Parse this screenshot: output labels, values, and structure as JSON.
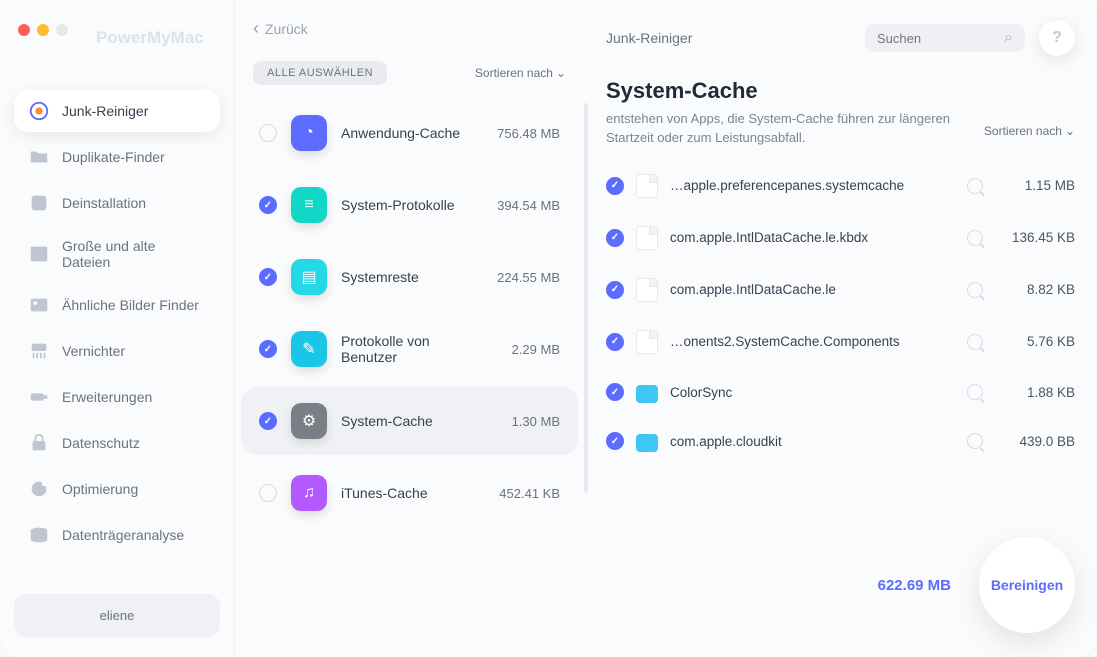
{
  "brand": "PowerMyMac",
  "back_label": "Zurück",
  "page_title": "Junk-Reiniger",
  "search": {
    "placeholder": "Suchen"
  },
  "help_label": "?",
  "sidebar": {
    "items": [
      {
        "label": "Junk-Reiniger",
        "active": true,
        "icon": "junk"
      },
      {
        "label": "Duplikate-Finder",
        "icon": "folder"
      },
      {
        "label": "Deinstallation",
        "icon": "app"
      },
      {
        "label": "Große und alte Dateien",
        "icon": "box"
      },
      {
        "label": "Ähnliche Bilder Finder",
        "icon": "image"
      },
      {
        "label": "Vernichter",
        "icon": "shred"
      },
      {
        "label": "Erweiterungen",
        "icon": "ext"
      },
      {
        "label": "Datenschutz",
        "icon": "lock"
      },
      {
        "label": "Optimierung",
        "icon": "opt"
      },
      {
        "label": "Datenträgeranalyse",
        "icon": "disk"
      }
    ],
    "user": "eliene"
  },
  "select_all": "ALLE AUSWÄHLEN",
  "sort_by": "Sortieren nach",
  "categories": [
    {
      "name": "Anwendung-Cache",
      "size": "756.48 MB",
      "checked": false,
      "color": "#5b6cff",
      "glyph": "clock"
    },
    {
      "name": "System-Protokolle",
      "size": "394.54 MB",
      "checked": true,
      "color": "#12d7c7",
      "glyph": "list"
    },
    {
      "name": "Systemreste",
      "size": "224.55 MB",
      "checked": true,
      "color": "#25d8e5",
      "glyph": "page"
    },
    {
      "name": "Protokolle von Benutzer",
      "size": "2.29 MB",
      "checked": true,
      "color": "#19c6e6",
      "glyph": "brush"
    },
    {
      "name": "System-Cache",
      "size": "1.30 MB",
      "checked": true,
      "color": "#7a7f87",
      "glyph": "gear",
      "selected": true
    },
    {
      "name": "iTunes-Cache",
      "size": "452.41 KB",
      "checked": false,
      "color": "#b259ff",
      "glyph": "music"
    }
  ],
  "detail": {
    "title": "System-Cache",
    "subtitle": "entstehen von Apps, die System-Cache führen zur längeren Startzeit oder zum Leistungsabfall.",
    "sort_by": "Sortieren nach",
    "files": [
      {
        "name": "…apple.preferencepanes.systemcache",
        "size": "1.15 MB",
        "type": "file"
      },
      {
        "name": "com.apple.IntlDataCache.le.kbdx",
        "size": "136.45 KB",
        "type": "file"
      },
      {
        "name": "com.apple.IntlDataCache.le",
        "size": "8.82 KB",
        "type": "file"
      },
      {
        "name": "…onents2.SystemCache.Components",
        "size": "5.76 KB",
        "type": "file"
      },
      {
        "name": "ColorSync",
        "size": "1.88 KB",
        "type": "folder"
      },
      {
        "name": "com.apple.cloudkit",
        "size": "439.0 BB",
        "type": "folder"
      }
    ]
  },
  "total_size": "622.69 MB",
  "clean_label": "Bereinigen"
}
